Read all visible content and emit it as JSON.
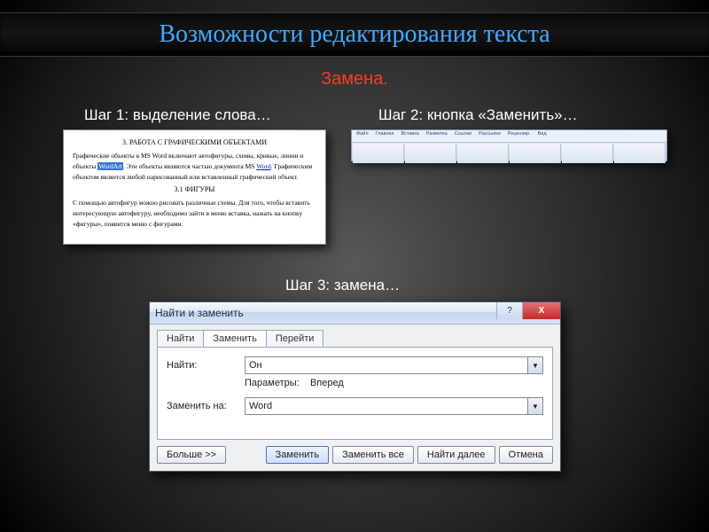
{
  "title": "Возможности редактирования текста",
  "subtitle": "Замена.",
  "steps": {
    "s1": "Шаг 1: выделение слова…",
    "s2": "Шаг 2: кнопка «Заменить»…",
    "s3": "Шаг 3: замена…"
  },
  "doc": {
    "h1": "3. РАБОТА С ГРАФИЧЕСКИМИ ОБЪЕКТАМИ",
    "p1a": "Графические объекты в MS Word включают автофигуры, схемы, кривые, линии и объекты ",
    "p1hl": "WordArt",
    "p1b": ". Эти объекты являются частью документа MS ",
    "p1u": "Word",
    "p1c": ". Графическим объектом является любой нарисованный или вставленный графический объект.",
    "h2": "3.1 ФИГУРЫ",
    "p2": "С помощью автофигур можно рисовать различные схемы. Для того, чтобы вставить интересующую автофигуру, необходимо зайти в меню вставка, нажать на кнопку «фигуры», появится меню с фигурами."
  },
  "ribbon": {
    "tabs": [
      "Файл",
      "Главная",
      "Вставка",
      "Разметка",
      "Ссылки",
      "Рассылки",
      "Рецензир.",
      "Вид"
    ]
  },
  "dialog": {
    "title": "Найти и заменить",
    "help": "?",
    "close": "X",
    "tabs": {
      "find": "Найти",
      "replace": "Заменить",
      "goto": "Перейти"
    },
    "find_label": "Найти:",
    "find_value": "Он",
    "params_label": "Параметры:",
    "params_value": "Вперед",
    "replace_label": "Заменить на:",
    "replace_value": "Word",
    "buttons": {
      "more": "Больше >>",
      "replace": "Заменить",
      "replace_all": "Заменить все",
      "find_next": "Найти далее",
      "cancel": "Отмена"
    }
  }
}
